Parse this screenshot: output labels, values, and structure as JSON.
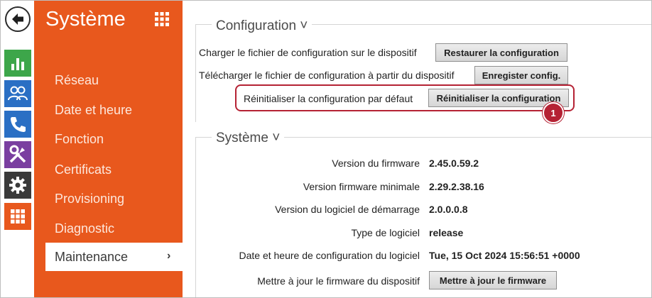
{
  "colors": {
    "sidebar_bg": "#e8581d",
    "accent_red": "#b52234",
    "rail_green": "#3da64a",
    "rail_blue": "#2a6fc4",
    "rail_purple": "#7a3fa0",
    "rail_dark": "#3a3a3a",
    "rail_orange": "#e8581d"
  },
  "rail": {
    "items": [
      {
        "icon": "back-arrow-icon"
      },
      {
        "icon": "bar-chart-icon"
      },
      {
        "icon": "users-icon"
      },
      {
        "icon": "phone-icon"
      },
      {
        "icon": "tools-icon"
      },
      {
        "icon": "gear-icon"
      },
      {
        "icon": "grid-icon"
      }
    ]
  },
  "sidebar": {
    "title": "Système",
    "items": [
      {
        "label": "Réseau"
      },
      {
        "label": "Date et heure"
      },
      {
        "label": "Fonction"
      },
      {
        "label": "Certificats"
      },
      {
        "label": "Provisioning"
      },
      {
        "label": "Diagnostic"
      }
    ],
    "active": {
      "label": "Maintenance",
      "chevron": "›"
    }
  },
  "configuration": {
    "header": "Configuration ˅",
    "rows": [
      {
        "label": "Charger le fichier de configuration sur le dispositif",
        "button": "Restaurer la configuration"
      },
      {
        "label": "Télécharger le fichier de configuration à partir du dispositif",
        "button": "Enregister config."
      },
      {
        "label": "Réinitialiser la configuration par défaut",
        "button": "Réinitialiser la configuration"
      }
    ],
    "callout": "1"
  },
  "systeme": {
    "header": "Système ˅",
    "rows": [
      {
        "label": "Version du firmware",
        "value": "2.45.0.59.2"
      },
      {
        "label": "Version firmware minimale",
        "value": "2.29.2.38.16"
      },
      {
        "label": "Version du logiciel de démarrage",
        "value": "2.0.0.0.8"
      },
      {
        "label": "Type de logiciel",
        "value": "release"
      },
      {
        "label": "Date et heure de configuration du logiciel",
        "value": "Tue, 15 Oct 2024 15:56:51 +0000"
      }
    ],
    "update": {
      "label": "Mettre à jour le firmware du dispositif",
      "button": "Mettre à jour le firmware"
    }
  }
}
